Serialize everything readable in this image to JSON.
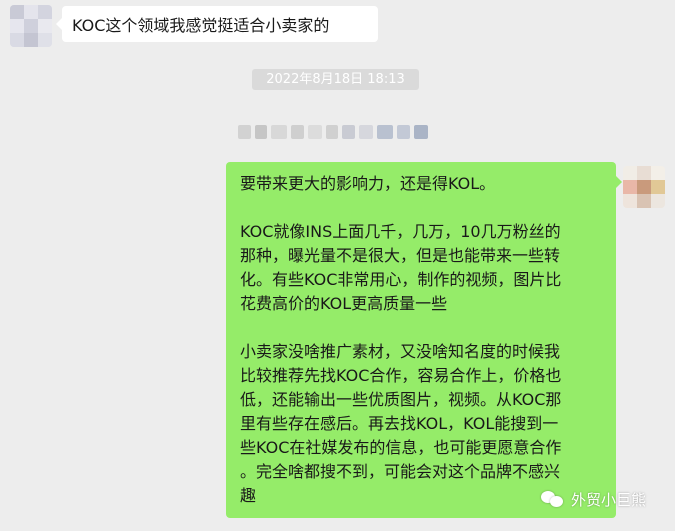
{
  "messages": {
    "incoming": {
      "text": "KOC这个领域我感觉挺适合小卖家的"
    },
    "timestamp": "2022年8月18日 18:13",
    "outgoing": {
      "paragraphs": [
        [
          "要带来更大的影响力，还是得KOL。"
        ],
        [
          "KOC就像INS上面几千，几万，10几万粉丝的",
          "那种，曝光量不是很大，但是也能带来一些转",
          "化。有些KOC非常用心，制作的视频，图片比",
          "花费高价的KOL更高质量一些"
        ],
        [
          "小卖家没啥推广素材，又没啥知名度的时候我",
          "比较推荐先找KOC合作，容易合作上，价格也",
          "低，还能输出一些优质图片，视频。从KOC那",
          "里有些存在感后。再去找KOL，KOL能搜到一",
          "些KOC在社媒发布的信息，也可能更愿意合作",
          "。完全啥都搜不到，可能会对这个品牌不感兴",
          "趣"
        ]
      ]
    }
  },
  "watermark": {
    "icon": "wechat-icon",
    "text": "外贸小巨熊"
  },
  "colors": {
    "background": "#ededed",
    "incoming_bubble": "#ffffff",
    "outgoing_bubble": "#95ec69",
    "timestamp_bg": "#dadada"
  }
}
